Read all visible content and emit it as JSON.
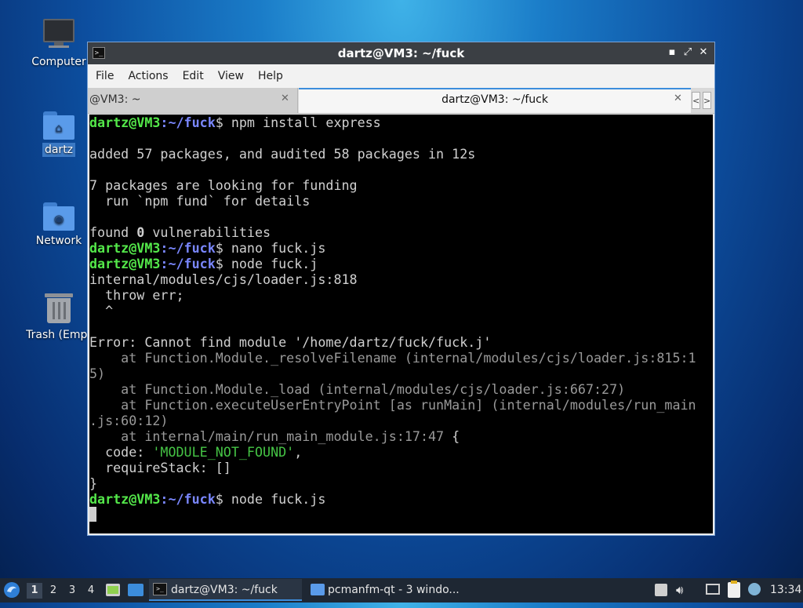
{
  "desktop": {
    "icons": [
      {
        "label": "Computer",
        "icon": "computer-icon"
      },
      {
        "label": "dartz",
        "icon": "home-folder-icon"
      },
      {
        "label": "Network",
        "icon": "network-folder-icon"
      },
      {
        "label": "Trash (Empt",
        "icon": "trash-icon"
      }
    ]
  },
  "window": {
    "title": "dartz@VM3: ~/fuck",
    "controls": {
      "minimize": "▪",
      "maximize": "⤢",
      "close": "✕"
    },
    "menu": [
      "File",
      "Actions",
      "Edit",
      "View",
      "Help"
    ],
    "tabs": [
      {
        "label": "@VM3: ~",
        "active": false,
        "close": "✕"
      },
      {
        "label": "dartz@VM3: ~/fuck",
        "active": true,
        "close": "✕"
      }
    ],
    "tab_scroll": {
      "left": "<",
      "right": ">"
    }
  },
  "terminal": {
    "prompt_user": "dartz@VM3",
    "prompt_path": ":~/fuck",
    "prompt_sym": "$",
    "lines": [
      {
        "kind": "prompt",
        "cmd": " npm install express"
      },
      {
        "kind": "blank"
      },
      {
        "kind": "plain",
        "text": "added 57 packages, and audited 58 packages in 12s"
      },
      {
        "kind": "blank"
      },
      {
        "kind": "plain",
        "text": "7 packages are looking for funding"
      },
      {
        "kind": "plain",
        "text": "  run `npm fund` for details"
      },
      {
        "kind": "blank"
      },
      {
        "kind": "vuln",
        "before": "found ",
        "num": "0",
        "after": " vulnerabilities"
      },
      {
        "kind": "prompt",
        "cmd": " nano fuck.js"
      },
      {
        "kind": "prompt",
        "cmd": " node fuck.j"
      },
      {
        "kind": "plain",
        "text": "internal/modules/cjs/loader.js:818"
      },
      {
        "kind": "plain",
        "text": "  throw err;"
      },
      {
        "kind": "plain",
        "text": "  ^"
      },
      {
        "kind": "blank"
      },
      {
        "kind": "plain",
        "text": "Error: Cannot find module '/home/dartz/fuck/fuck.j'"
      },
      {
        "kind": "dim",
        "text": "    at Function.Module._resolveFilename (internal/modules/cjs/loader.js:815:1"
      },
      {
        "kind": "dim",
        "text": "5)"
      },
      {
        "kind": "dim",
        "text": "    at Function.Module._load (internal/modules/cjs/loader.js:667:27)"
      },
      {
        "kind": "dim",
        "text": "    at Function.executeUserEntryPoint [as runMain] (internal/modules/run_main"
      },
      {
        "kind": "dim",
        "text": ".js:60:12)"
      },
      {
        "kind": "dimbrace",
        "text": "    at internal/main/run_main_module.js:17:47",
        "brace": " {"
      },
      {
        "kind": "code",
        "before": "  code: ",
        "str": "'MODULE_NOT_FOUND'",
        "after": ","
      },
      {
        "kind": "plain",
        "text": "  requireStack: []"
      },
      {
        "kind": "plain",
        "text": "}"
      },
      {
        "kind": "prompt",
        "cmd": " node fuck.js"
      },
      {
        "kind": "cursor"
      }
    ]
  },
  "taskbar": {
    "start_icon": "lxqt-menu-icon",
    "workspaces": [
      "1",
      "2",
      "3",
      "4"
    ],
    "active_workspace": "1",
    "quicklaunch": [
      "file-manager-icon",
      "show-desktop-icon"
    ],
    "tasks": [
      {
        "label": "dartz@VM3: ~/fuck",
        "icon": "terminal-icon",
        "active": true
      },
      {
        "label": "pcmanfm-qt - 3 windo...",
        "icon": "folder-icon",
        "active": false
      }
    ],
    "tray": [
      "screenshot-icon",
      "volume-icon",
      "network-icon",
      "clipboard-icon",
      "update-notifier-icon"
    ],
    "clock": "13:34"
  }
}
